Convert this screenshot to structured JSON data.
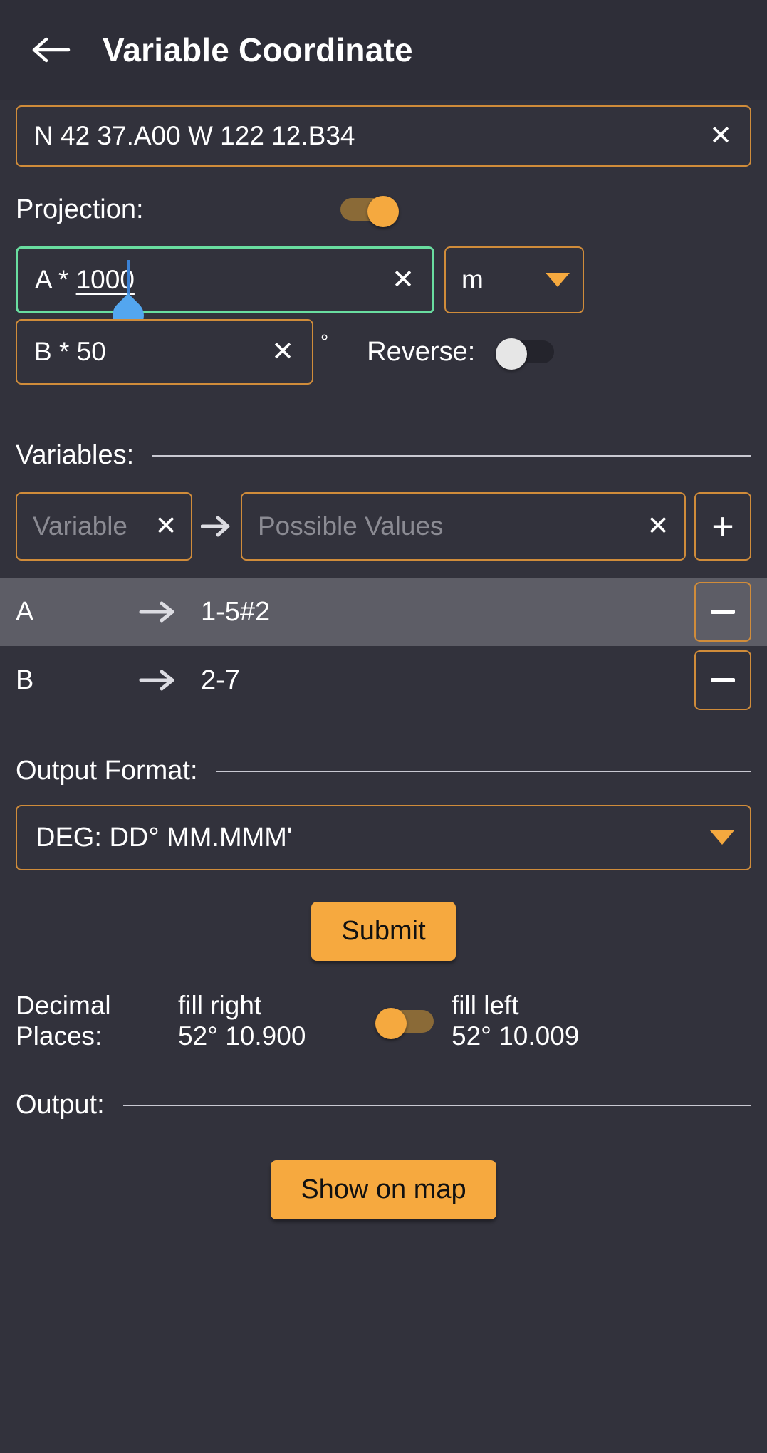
{
  "header": {
    "back_icon": "arrow-left-icon",
    "title": "Variable Coordinate"
  },
  "coordinate": {
    "value": "N 42 37.A00 W 122 12.B34",
    "clear_icon": "close-icon"
  },
  "projection": {
    "label": "Projection:",
    "toggle_state": "on"
  },
  "expression_a": {
    "value_prefix": "A * ",
    "value_composing": "1000",
    "clear_icon": "close-icon",
    "focused": true,
    "unit": "m",
    "unit_caret_icon": "chevron-down-icon"
  },
  "expression_b": {
    "value": "B * 50",
    "clear_icon": "close-icon",
    "degree_symbol": "°"
  },
  "reverse": {
    "label": "Reverse:",
    "toggle_state": "off"
  },
  "variables": {
    "heading": "Variables:",
    "name_placeholder": "Variable",
    "values_placeholder": "Possible Values",
    "arrow_icon": "arrow-right-icon",
    "clear_icon": "close-icon",
    "add_label": "+",
    "rows": [
      {
        "key": "A",
        "arrow": "→",
        "value": "1-5#2",
        "remove_icon": "minus-icon",
        "selected": true
      },
      {
        "key": "B",
        "arrow": "→",
        "value": "2-7",
        "remove_icon": "minus-icon",
        "selected": false
      }
    ]
  },
  "output_format": {
    "heading": "Output Format:",
    "selected": "DEG: DD° MM.MMM'",
    "caret_icon": "chevron-down-icon"
  },
  "submit": {
    "label": "Submit"
  },
  "decimal_places": {
    "label_line1": "Decimal",
    "label_line2": "Places:",
    "left_option_label": "fill right",
    "left_option_example": "52° 10.900",
    "right_option_label": "fill left",
    "right_option_example": "52° 10.009",
    "toggle_state": "left"
  },
  "output": {
    "heading": "Output:"
  },
  "show_on_map": {
    "label": "Show on map"
  },
  "colors": {
    "background": "#32323c",
    "appbar": "#2e2e38",
    "accent_orange": "#f6a93f",
    "border_orange": "#d08c3a",
    "focus_green": "#69dda0",
    "selected_row": "#5d5d66",
    "caret_blue": "#53a6ef",
    "placeholder_grey": "#8b8b93"
  }
}
